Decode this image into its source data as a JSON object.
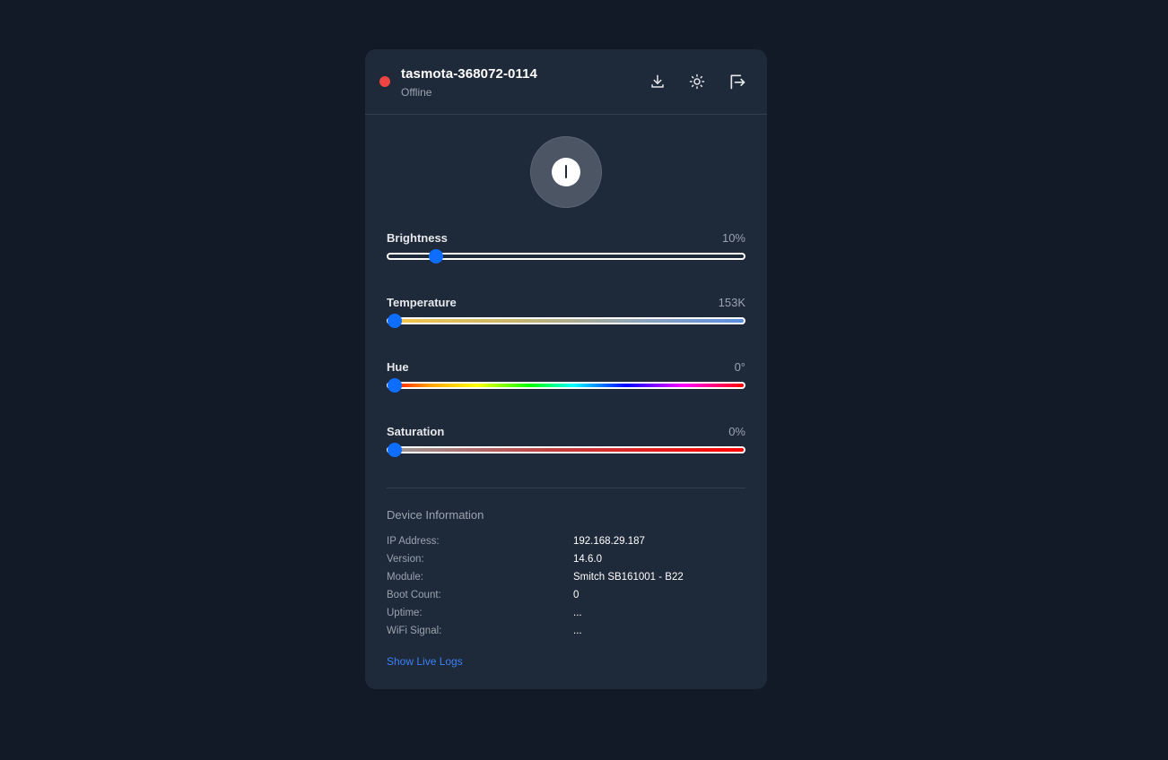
{
  "device": {
    "name": "tasmota-368072-0114",
    "status": "Offline",
    "status_color": "#ef4444"
  },
  "header_actions": [
    {
      "icon": "download-icon"
    },
    {
      "icon": "sun-icon"
    },
    {
      "icon": "logout-icon"
    }
  ],
  "power": {
    "icon": "power-icon"
  },
  "sliders": {
    "brightness": {
      "label": "Brightness",
      "value_text": "10%",
      "fraction": 0.12
    },
    "temperature": {
      "label": "Temperature",
      "value_text": "153K",
      "fraction": 0.0
    },
    "hue": {
      "label": "Hue",
      "value_text": "0°",
      "fraction": 0.0
    },
    "saturation": {
      "label": "Saturation",
      "value_text": "0%",
      "fraction": 0.0
    }
  },
  "info": {
    "title": "Device Information",
    "rows": [
      {
        "key": "IP Address:",
        "value": "192.168.29.187"
      },
      {
        "key": "Version:",
        "value": "14.6.0"
      },
      {
        "key": "Module:",
        "value": "Smitch SB161001 - B22"
      },
      {
        "key": "Boot Count:",
        "value": "0"
      },
      {
        "key": "Uptime:",
        "value": "..."
      },
      {
        "key": "WiFi Signal:",
        "value": "..."
      }
    ]
  },
  "live_logs_label": "Show Live Logs",
  "colors": {
    "background": "#121a28",
    "card": "#1e2939",
    "accent": "#0d6efd",
    "link": "#3b82f6"
  }
}
